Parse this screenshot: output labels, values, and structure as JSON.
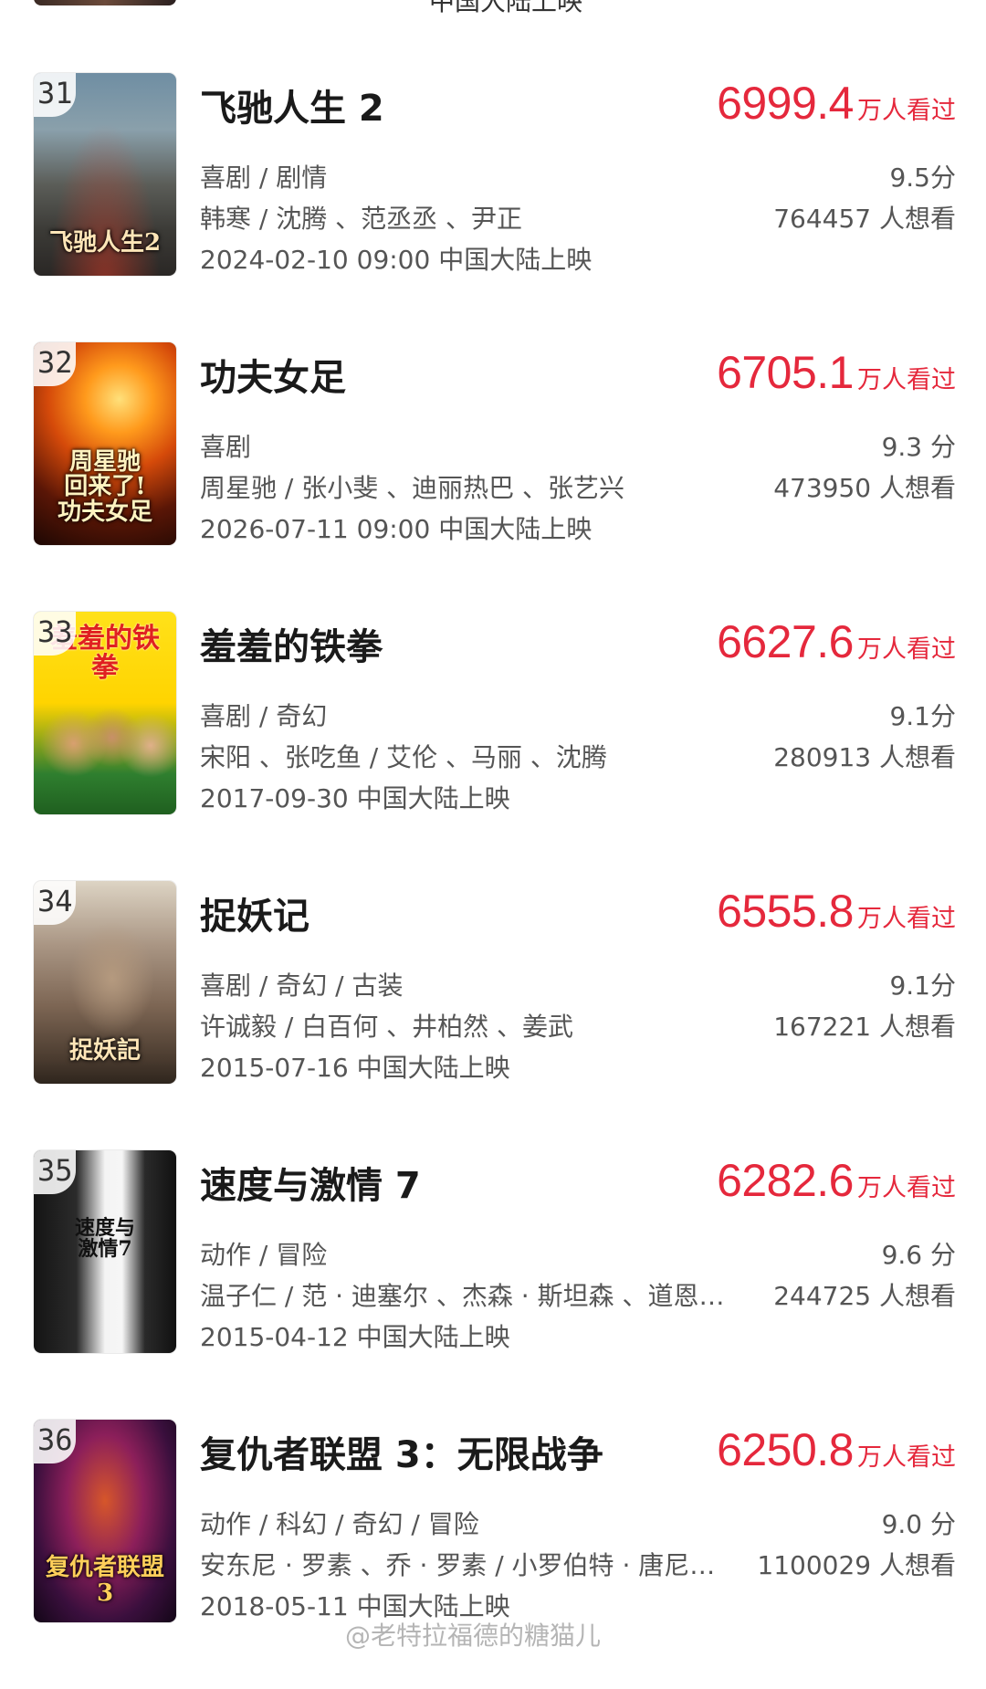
{
  "top_partial": {
    "text": "中国大陆上映"
  },
  "movies": [
    {
      "rank": "31",
      "title": "飞驰人生 2",
      "views": "6999.4",
      "views_unit": "万人看过",
      "genre": "喜剧 / 剧情",
      "cast": "韩寒 / 沈腾 、范丞丞 、尹正",
      "release": "2024-02-10 09:00 中国大陆上映",
      "score": "9.5分",
      "want": "764457 人想看",
      "poster_text": "飞驰人生2"
    },
    {
      "rank": "32",
      "title": "功夫女足",
      "views": "6705.1",
      "views_unit": "万人看过",
      "genre": "喜剧",
      "cast": "周星驰 / 张小斐 、迪丽热巴 、张艺兴",
      "release": "2026-07-11 09:00 中国大陆上映",
      "score": "9.3 分",
      "want": "473950 人想看",
      "poster_text": "周星驰\n回来了!\n功夫女足"
    },
    {
      "rank": "33",
      "title": "羞羞的铁拳",
      "views": "6627.6",
      "views_unit": "万人看过",
      "genre": "喜剧 / 奇幻",
      "cast": "宋阳 、张吃鱼 / 艾伦 、马丽 、沈腾",
      "release": "2017-09-30 中国大陆上映",
      "score": "9.1分",
      "want": "280913 人想看",
      "poster_text": "羞羞的铁拳"
    },
    {
      "rank": "34",
      "title": "捉妖记",
      "views": "6555.8",
      "views_unit": "万人看过",
      "genre": "喜剧 / 奇幻 / 古装",
      "cast": "许诚毅 / 白百何 、井柏然 、姜武",
      "release": "2015-07-16 中国大陆上映",
      "score": "9.1分",
      "want": "167221 人想看",
      "poster_text": "捉妖記"
    },
    {
      "rank": "35",
      "title": "速度与激情 7",
      "views": "6282.6",
      "views_unit": "万人看过",
      "genre": "动作 / 冒险",
      "cast": "温子仁 / 范 · 迪塞尔 、杰森 · 斯坦森 、道恩…",
      "release": "2015-04-12 中国大陆上映",
      "score": "9.6 分",
      "want": "244725 人想看",
      "poster_text": "速度与\n激情7"
    },
    {
      "rank": "36",
      "title": "复仇者联盟 3：无限战争",
      "views": "6250.8",
      "views_unit": "万人看过",
      "genre": "动作 / 科幻 / 奇幻 / 冒险",
      "cast": "安东尼 · 罗素 、乔 · 罗素 / 小罗伯特 · 唐尼…",
      "release": "2018-05-11 中国大陆上映",
      "score": "9.0 分",
      "want": "1100029 人想看",
      "poster_text": "复仇者联盟3"
    }
  ],
  "watermark": "@老特拉福德的糖猫儿",
  "colors": {
    "views_red": "#e5283c",
    "text_dark": "#1a1a1a",
    "text_gray": "#555555"
  }
}
